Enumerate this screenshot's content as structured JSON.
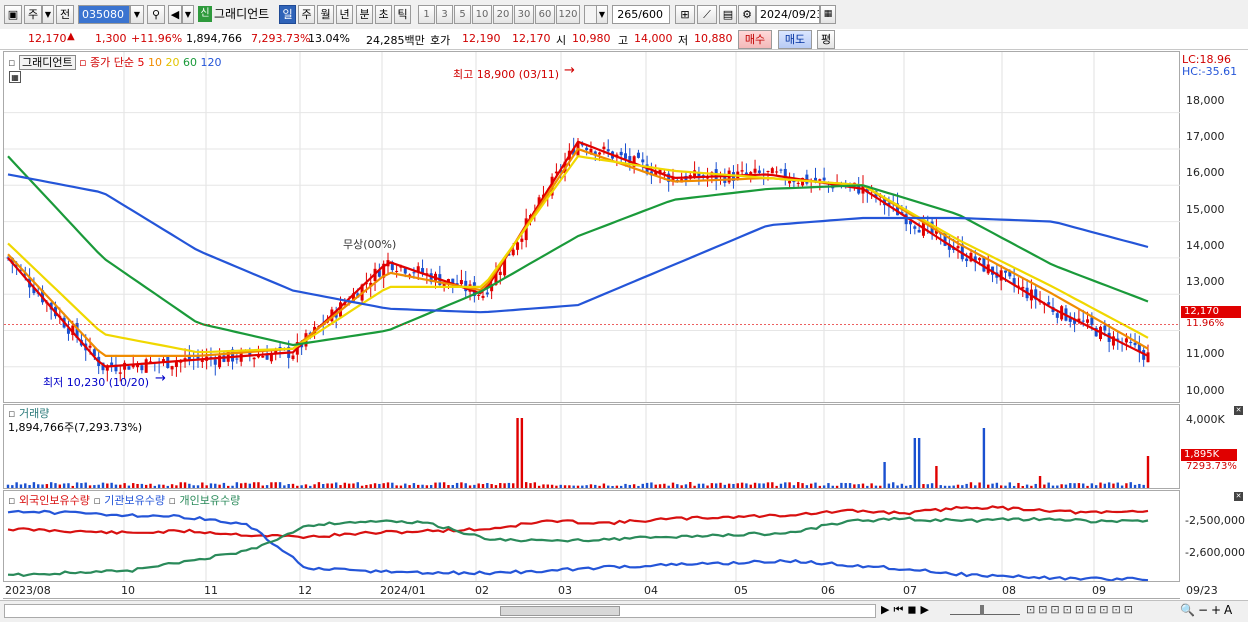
{
  "toolbar": {
    "mode": "주",
    "prev": "전",
    "code": "035080",
    "sin_badge": "신",
    "stock_name": "그래디언트",
    "periods": [
      "일",
      "주",
      "월",
      "년",
      "분",
      "초",
      "틱"
    ],
    "active_period": "일",
    "intervals": [
      "1",
      "3",
      "5",
      "10",
      "20",
      "30",
      "60",
      "120"
    ],
    "count": "265",
    "count_max": "/600",
    "date": "2024/09/23"
  },
  "quote": {
    "price": "12,170",
    "change": "1,300",
    "change_pct": "+11.96%",
    "volume": "1,894,766",
    "volume_pct": "7,293.73%",
    "turnover": "13.04%",
    "amount": "24,285백만",
    "hoga_label": "호가",
    "hoga_ask": "12,190",
    "hoga_bid": "12,170",
    "open_label": "시",
    "open": "10,980",
    "high_label": "고",
    "high": "14,000",
    "low_label": "저",
    "low": "10,880",
    "buy_label": "매수",
    "sell_label": "매도",
    "eval_label": "평"
  },
  "price_panel": {
    "name": "그래디언트",
    "ma_label": "종가 단순",
    "ma_periods": [
      "5",
      "10",
      "20",
      "60",
      "120"
    ],
    "ma_colors": [
      "#e00000",
      "#f08c00",
      "#f0d800",
      "#1a9a3a",
      "#2455d8"
    ],
    "lc": "LC:18.96",
    "hc": "HC:-35.61",
    "max_label": "최고 18,900 (03/11)",
    "min_label": "최저 10,230 (10/20)",
    "mid_label": "무상(00%)",
    "y_ticks": [
      "18,000",
      "17,000",
      "16,000",
      "15,000",
      "14,000",
      "13,000",
      "12,000",
      "11,000",
      "10,000"
    ],
    "price_tag": "12,170",
    "pct_tag": "11.96%"
  },
  "volume_panel": {
    "title": "거래량",
    "value": "1,894,766주(7,293.73%)",
    "y_tick": "4,000K",
    "tag": "1,895K",
    "pct": "7293.73%"
  },
  "holding_panel": {
    "series": [
      "외국인보유수량",
      "기관보유수량",
      "개인보유수량"
    ],
    "series_colors": [
      "#d81010",
      "#2455d8",
      "#2a8a5a"
    ],
    "y_ticks": [
      "-2,500,000",
      "-2,600,000"
    ]
  },
  "x_axis": [
    "2023/08",
    "10",
    "11",
    "12",
    "2024/01",
    "02",
    "03",
    "04",
    "05",
    "06",
    "07",
    "08",
    "09",
    "09/23"
  ],
  "colors": {
    "up": "#e00000",
    "down": "#1a50d0",
    "toolbar": "#f0f0f0"
  },
  "chart_data": {
    "type": "line",
    "title": "그래디언트",
    "x": [
      "2023/08",
      "10",
      "11",
      "12",
      "2024/01",
      "02",
      "03",
      "04",
      "05",
      "06",
      "07",
      "08",
      "09",
      "09/23"
    ],
    "ylim": [
      10000,
      18900
    ],
    "series": [
      {
        "name": "종가 단순 5",
        "values": [
          14000,
          11000,
          11200,
          11400,
          13900,
          13000,
          17200,
          16200,
          16300,
          15900,
          14200,
          12600,
          11300
        ]
      },
      {
        "name": "종가 단순 10",
        "values": [
          14100,
          11300,
          11300,
          11500,
          13600,
          13100,
          17000,
          16100,
          16200,
          16000,
          14400,
          13000,
          11500
        ]
      },
      {
        "name": "종가 단순 20",
        "values": [
          14400,
          11900,
          11400,
          11500,
          13200,
          13200,
          16800,
          16400,
          16200,
          16000,
          14500,
          13200,
          11800
        ]
      },
      {
        "name": "종가 단순 60",
        "values": [
          16800,
          14000,
          12200,
          11600,
          12000,
          13100,
          14600,
          15600,
          15900,
          16000,
          15200,
          13800,
          12800
        ]
      },
      {
        "name": "종가 단순 120",
        "values": [
          16300,
          15800,
          14200,
          13100,
          12600,
          12500,
          12700,
          13800,
          14900,
          15100,
          15100,
          15000,
          14300
        ]
      }
    ],
    "annotations": [
      "최고 18,900 (03/11)",
      "최저 10,230 (10/20)"
    ],
    "yticks": [
      "18,000",
      "17,000",
      "16,000",
      "15,000",
      "14,000",
      "13,000",
      "12,000",
      "11,000",
      "10,000"
    ]
  }
}
